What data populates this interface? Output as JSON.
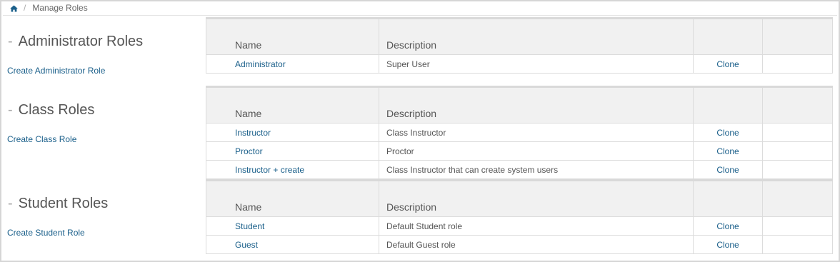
{
  "breadcrumb": {
    "home_icon": "home-icon",
    "separator": "/",
    "current": "Manage Roles"
  },
  "colors": {
    "link": "#1a5f8a",
    "header_bg": "#f1f1f1",
    "border": "#dcdcdc"
  },
  "sections": [
    {
      "title": "Administrator Roles",
      "dash": "-",
      "create_label": "Create Administrator Role",
      "columns": [
        "Name",
        "Description",
        "",
        ""
      ],
      "rows": [
        {
          "name": "Administrator",
          "description": "Super User",
          "action": "Clone"
        }
      ]
    },
    {
      "title": "Class Roles",
      "dash": "-",
      "create_label": "Create Class Role",
      "columns": [
        "Name",
        "Description",
        "",
        ""
      ],
      "rows": [
        {
          "name": "Instructor",
          "description": "Class Instructor",
          "action": "Clone"
        },
        {
          "name": "Proctor",
          "description": "Proctor",
          "action": "Clone"
        },
        {
          "name": "Instructor + create",
          "description": "Class Instructor that can create system users",
          "action": "Clone"
        }
      ]
    },
    {
      "title": "Student Roles",
      "dash": "-",
      "create_label": "Create Student Role",
      "columns": [
        "Name",
        "Description",
        "",
        ""
      ],
      "rows": [
        {
          "name": "Student",
          "description": "Default Student role",
          "action": "Clone"
        },
        {
          "name": "Guest",
          "description": "Default Guest role",
          "action": "Clone"
        }
      ]
    }
  ]
}
